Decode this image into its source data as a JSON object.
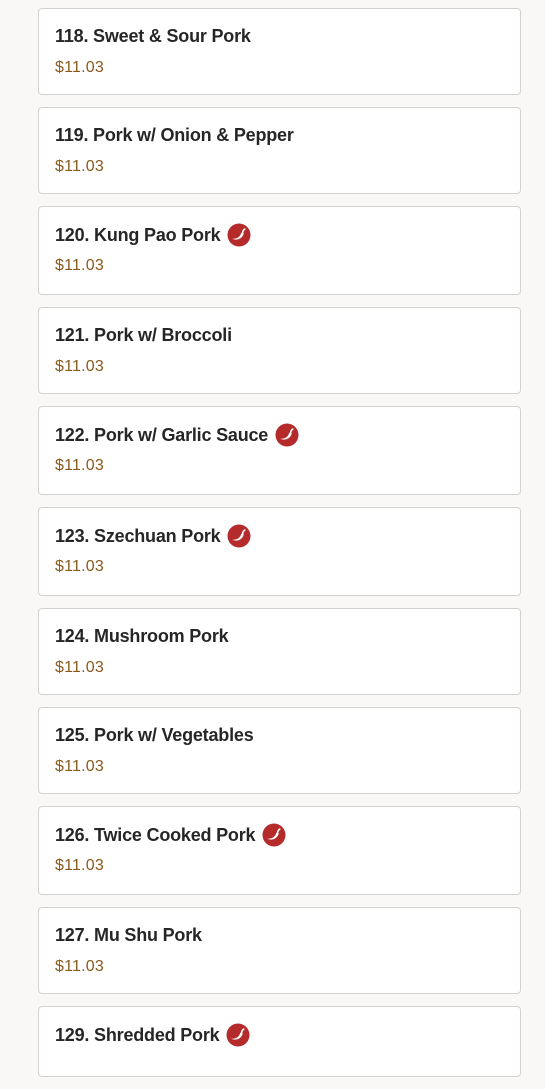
{
  "colors": {
    "page_background": "#f9f8f6",
    "card_background": "#ffffff",
    "card_border": "#d4d2ce",
    "item_name": "#262626",
    "price": "#8a5a1d",
    "spicy_icon": "#b52a2a"
  },
  "menu": {
    "items": [
      {
        "name": "118. Sweet & Sour Pork",
        "price": "$11.03",
        "spicy": false,
        "icon": ""
      },
      {
        "name": "119. Pork w/ Onion & Pepper",
        "price": "$11.03",
        "spicy": false,
        "icon": ""
      },
      {
        "name": "120. Kung Pao Pork",
        "price": "$11.03",
        "spicy": true,
        "icon": "spicy-pepper-icon"
      },
      {
        "name": "121. Pork w/ Broccoli",
        "price": "$11.03",
        "spicy": false,
        "icon": ""
      },
      {
        "name": "122. Pork w/ Garlic Sauce",
        "price": "$11.03",
        "spicy": true,
        "icon": "spicy-pepper-icon"
      },
      {
        "name": "123. Szechuan Pork",
        "price": "$11.03",
        "spicy": true,
        "icon": "spicy-pepper-icon"
      },
      {
        "name": "124. Mushroom Pork",
        "price": "$11.03",
        "spicy": false,
        "icon": ""
      },
      {
        "name": "125. Pork w/ Vegetables",
        "price": "$11.03",
        "spicy": false,
        "icon": ""
      },
      {
        "name": "126. Twice Cooked Pork",
        "price": "$11.03",
        "spicy": true,
        "icon": "spicy-pepper-icon"
      },
      {
        "name": "127. Mu Shu Pork",
        "price": "$11.03",
        "spicy": false,
        "icon": ""
      },
      {
        "name": "129. Shredded Pork",
        "price": "",
        "spicy": true,
        "icon": "spicy-pepper-icon"
      }
    ]
  }
}
